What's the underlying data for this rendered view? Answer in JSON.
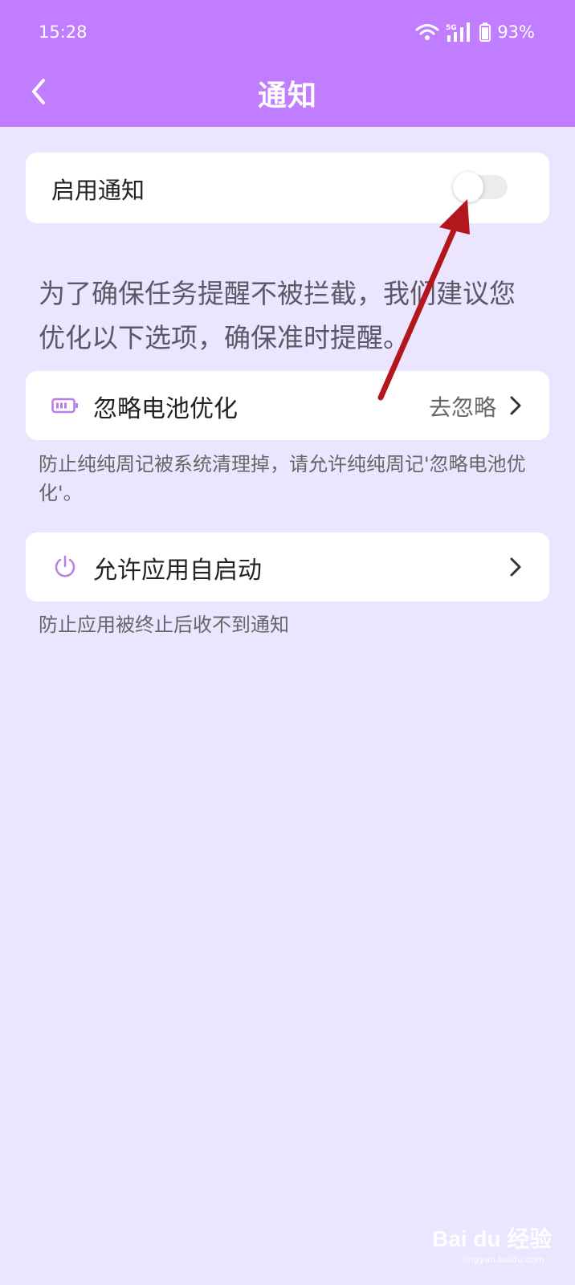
{
  "status_bar": {
    "time": "15:28",
    "network": "5G",
    "battery": "93%"
  },
  "header": {
    "title": "通知",
    "background": "#c17dff"
  },
  "enable_notification": {
    "label": "启用通知",
    "toggle_on": false
  },
  "notice_text": "为了确保任务提醒不被拦截，我们建议您优化以下选项，确保准时提醒。",
  "battery_optimization": {
    "label": "忽略电池优化",
    "action": "去忽略",
    "icon": "battery-icon",
    "description": "防止纯纯周记被系统清理掉，请允许纯纯周记'忽略电池优化'。"
  },
  "auto_start": {
    "label": "允许应用自启动",
    "icon": "power-icon",
    "description": "防止应用被终止后收不到通知"
  },
  "watermark": {
    "logo": "Bai du 经验",
    "url": "jingyan.baidu.com"
  },
  "colors": {
    "accent": "#c17dff",
    "page_background": "#ebe5ff",
    "annotation_arrow": "#b3161d"
  }
}
